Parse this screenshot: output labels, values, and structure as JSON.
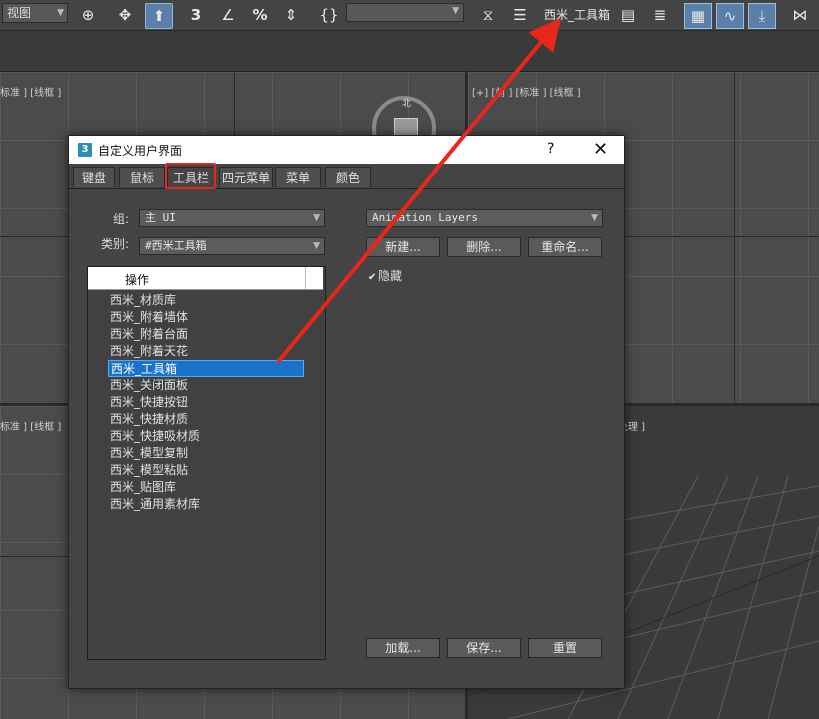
{
  "toolbar": {
    "view_dropdown": "视图",
    "toolbox_label": "西米_工具箱",
    "icons": [
      "select-link-icon",
      "move-icon",
      "select-object-icon",
      "snap-3d-icon",
      "angle-snap-icon",
      "percent-snap-icon",
      "spinner-snap-icon",
      "named-selection-icon",
      "mirror-icon",
      "align-icon",
      "layer-manager-icon",
      "scene-explorer-icon",
      "toggle-ribbon-icon",
      "curve-editor-icon",
      "render-setup-icon",
      "schematic-view-icon"
    ]
  },
  "viewports": {
    "top_left_label": "标准 ] [线框 ]",
    "top_right_label": "[+] [前 ] [标准 ] [线框 ]",
    "bottom_left_label": "标准 ] [线框 ]",
    "bottom_right_label": "处理 ]",
    "viewcube_north": "北"
  },
  "dialog": {
    "title": "自定义用户界面",
    "help": "?",
    "close": "✕",
    "app_icon": "3",
    "tabs": [
      {
        "label": "键盘"
      },
      {
        "label": "鼠标"
      },
      {
        "label": "工具栏"
      },
      {
        "label": "四元菜单"
      },
      {
        "label": "菜单"
      },
      {
        "label": "颜色"
      }
    ],
    "group_label": "组:",
    "group_value": "主 UI",
    "category_label": "类别:",
    "category_value": "#西米工具箱",
    "toolbar_select_value": "Animation Layers",
    "list_header": "操作",
    "list_items": [
      "西米_材质库",
      "西米_附着墙体",
      "西米_附着台面",
      "西米_附着天花",
      "西米_工具箱",
      "西米_关闭面板",
      "西米_快捷按钮",
      "西米_快捷材质",
      "西米_快捷吸材质",
      "西米_模型复制",
      "西米_模型粘贴",
      "西米_贴图库",
      "西米_通用素材库"
    ],
    "selected_item": "西米_工具箱",
    "buttons": {
      "new": "新建...",
      "delete": "删除...",
      "rename": "重命名..."
    },
    "hide_checkbox": {
      "label": "隐藏",
      "checked": true
    },
    "bottom_buttons": {
      "load": "加载...",
      "save": "保存...",
      "reset": "重置"
    }
  },
  "colors": {
    "annotation_red": "#e8261c",
    "selection_blue": "#1a73c8"
  }
}
